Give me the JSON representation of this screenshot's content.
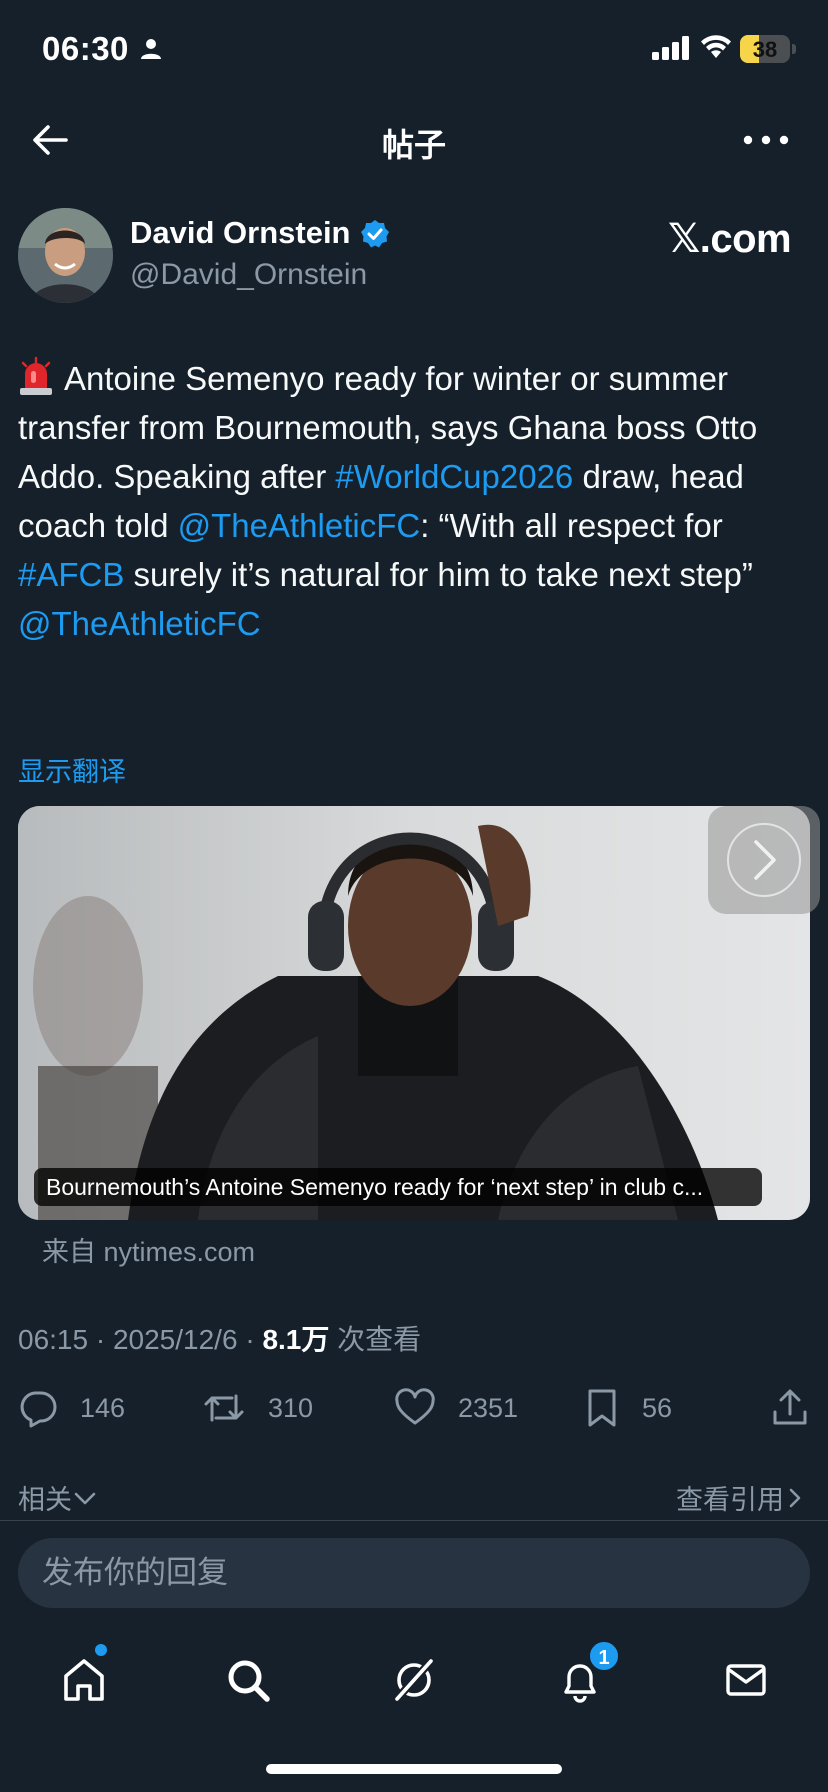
{
  "status_bar": {
    "time": "06:30",
    "battery": "38",
    "battery_level": 0.38,
    "icons": [
      "person-icon",
      "signal-icon",
      "wifi-icon",
      "battery-icon"
    ]
  },
  "header": {
    "title": "帖子",
    "back_icon": "arrow-left-icon",
    "more_icon": "more-dots-icon"
  },
  "author": {
    "name": "David Ornstein",
    "handle": "@David_Ornstein",
    "verified": true,
    "brand": "𝕏.com"
  },
  "tweet": {
    "emoji": "siren-emoji",
    "text_1": "Antoine Semenyo ready for winter or summer transfer from Bournemouth, says Ghana boss Otto Addo. Speaking after ",
    "link_1": "#WorldCup2026",
    "text_2": " draw, head coach told ",
    "link_2": "@TheAthleticFC",
    "text_3": ": “With all respect for ",
    "link_3": "#AFCB",
    "text_4": " surely it’s natural for him to take next step”",
    "link_4": "@TheAthleticFC",
    "translate": "显示翻译"
  },
  "card": {
    "caption": "Bournemouth’s Antoine Semenyo ready for ‘next step’ in club c...",
    "source": "来自 nytimes.com"
  },
  "meta": {
    "time": "06:15",
    "sep": " · ",
    "date": "2025/12/6",
    "views": "8.1万",
    "views_suffix": " 次查看"
  },
  "actions": {
    "replies": "146",
    "reposts": "310",
    "likes": "2351",
    "bookmarks": "56"
  },
  "related": {
    "label": "相关",
    "quotes": "查看引用"
  },
  "reply": {
    "placeholder": "发布你的回复"
  },
  "tabbar": {
    "notif_count": "1",
    "colors": {
      "accent": "#1d9bf0",
      "background": "#15202b",
      "muted": "#8b98a5"
    }
  }
}
